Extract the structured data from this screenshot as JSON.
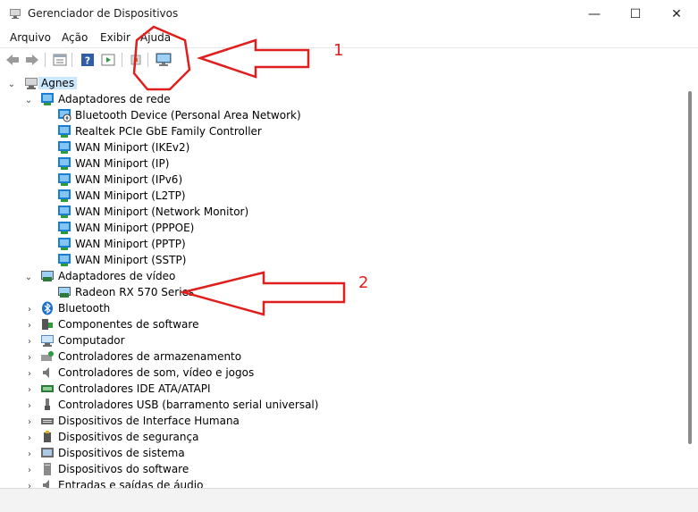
{
  "window": {
    "title": "Gerenciador de Dispositivos",
    "controls": {
      "minimize": "—",
      "maximize": "☐",
      "close": "✕"
    }
  },
  "menu": [
    "Arquivo",
    "Ação",
    "Exibir",
    "Ajuda"
  ],
  "toolbar": {
    "buttons": [
      "back-icon",
      "forward-icon",
      "properties-icon",
      "help-icon",
      "run-icon",
      "network-scan-icon",
      "computer-monitor-icon"
    ]
  },
  "tree": {
    "root": "Agnes",
    "network_adapters": {
      "label": "Adaptadores de rede",
      "items": [
        "Bluetooth Device (Personal Area Network)",
        "Realtek PCIe GbE Family Controller",
        "WAN Miniport (IKEv2)",
        "WAN Miniport (IP)",
        "WAN Miniport (IPv6)",
        "WAN Miniport (L2TP)",
        "WAN Miniport (Network Monitor)",
        "WAN Miniport (PPPOE)",
        "WAN Miniport (PPTP)",
        "WAN Miniport (SSTP)"
      ]
    },
    "video_adapters": {
      "label": "Adaptadores de vídeo",
      "items": [
        "Radeon RX 570 Series"
      ]
    },
    "categories": [
      "Bluetooth",
      "Componentes de software",
      "Computador",
      "Controladores de armazenamento",
      "Controladores de som, vídeo e jogos",
      "Controladores IDE ATA/ATAPI",
      "Controladores USB (barramento serial universal)",
      "Dispositivos de Interface Humana",
      "Dispositivos de segurança",
      "Dispositivos de sistema",
      "Dispositivos do software",
      "Entradas e saídas de áudio"
    ]
  },
  "annotations": {
    "number_1": "1",
    "number_2": "2",
    "color": "#e01e1e"
  }
}
